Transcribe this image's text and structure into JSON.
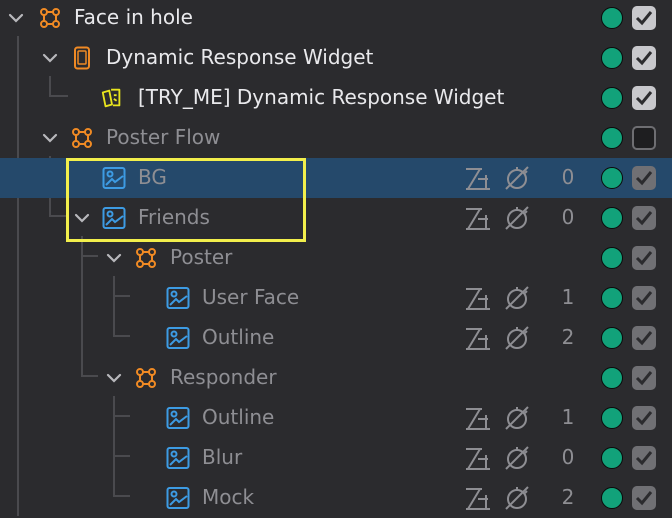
{
  "colors": {
    "accent_orange": "#f08a24",
    "image_blue": "#3d9be3",
    "widget_yellow": "#e8e41e",
    "visible_dot": "#12a27a",
    "selection": "#25496b",
    "highlight_box": "#f2ef4c"
  },
  "rows": [
    {
      "label": "Face in hole",
      "icon": "group-icon",
      "expanded": true,
      "visible": true,
      "checked": true
    },
    {
      "label": "Dynamic Response Widget",
      "icon": "device-icon",
      "expanded": true,
      "visible": true,
      "checked": true
    },
    {
      "label": "[TRY_ME] Dynamic Response Widget",
      "icon": "widget-cards-icon",
      "visible": true,
      "checked": true
    },
    {
      "label": "Poster Flow",
      "icon": "group-icon",
      "expanded": true,
      "visible": true,
      "checked": false
    },
    {
      "label": "BG",
      "icon": "image-icon",
      "order": "0",
      "visible": true,
      "checked": true,
      "selected": true
    },
    {
      "label": "Friends",
      "icon": "image-icon",
      "expanded": true,
      "order": "0",
      "visible": true,
      "checked": true
    },
    {
      "label": "Poster",
      "icon": "group-icon",
      "expanded": true,
      "visible": true,
      "checked": true
    },
    {
      "label": "User Face",
      "icon": "image-icon",
      "order": "1",
      "visible": true,
      "checked": true
    },
    {
      "label": "Outline",
      "icon": "image-icon",
      "order": "2",
      "visible": true,
      "checked": true
    },
    {
      "label": "Responder",
      "icon": "group-icon",
      "expanded": true,
      "visible": true,
      "checked": true
    },
    {
      "label": "Outline",
      "icon": "image-icon",
      "order": "1",
      "visible": true,
      "checked": true
    },
    {
      "label": "Blur",
      "icon": "image-icon",
      "order": "0",
      "visible": true,
      "checked": true
    },
    {
      "label": "Mock",
      "icon": "image-icon",
      "order": "2",
      "visible": true,
      "checked": true
    }
  ]
}
